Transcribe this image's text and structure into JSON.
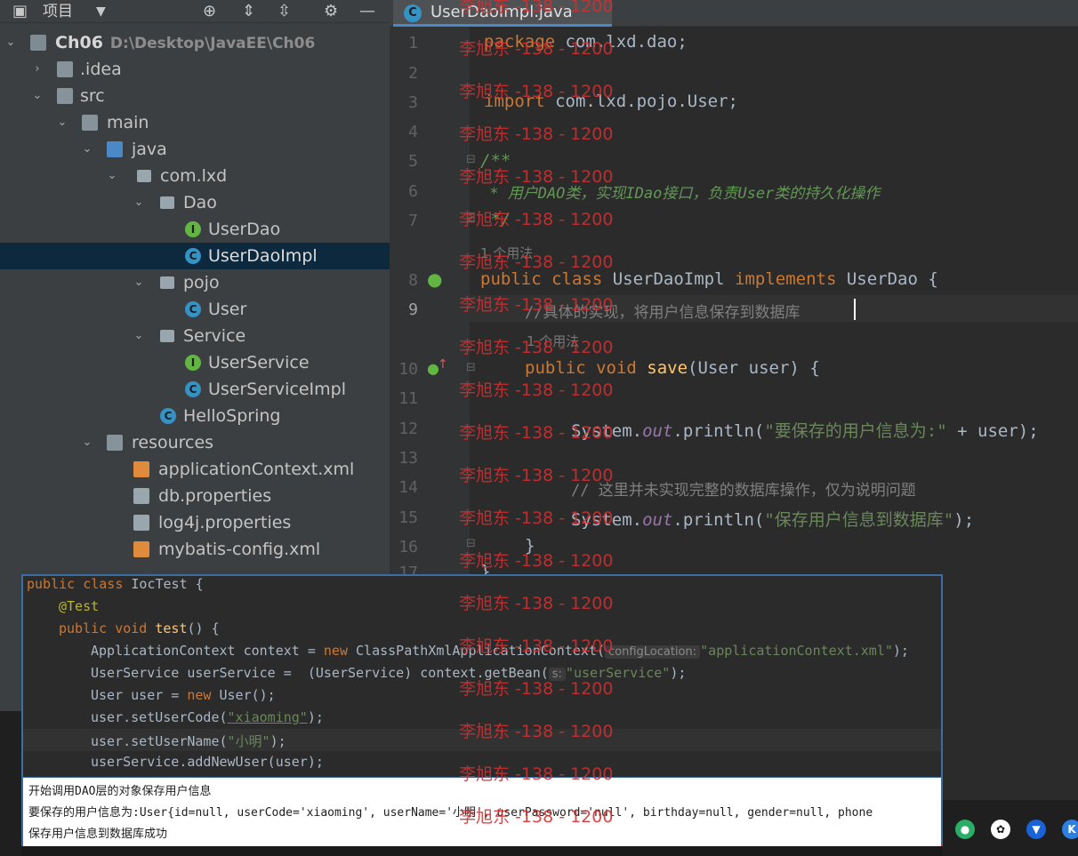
{
  "toolbar": {
    "title": "项目",
    "dropdown_icon": "chevron-down-icon",
    "crosshair_icon": "locate-icon",
    "expand_icon": "expand-all-icon",
    "collapse_icon": "collapse-all-icon",
    "settings_icon": "gear-icon",
    "minimize_icon": "minimize-icon"
  },
  "tree": {
    "root_name": "Ch06",
    "root_path": "D:\\Desktop\\JavaEE\\Ch06",
    "items": [
      {
        "label": ".idea",
        "icon": "folder-icon"
      },
      {
        "label": "src",
        "icon": "folder-icon"
      },
      {
        "label": "main",
        "icon": "folder-icon"
      },
      {
        "label": "java",
        "icon": "source-folder-icon"
      },
      {
        "label": "com.lxd",
        "icon": "package-icon"
      },
      {
        "label": "Dao",
        "icon": "package-icon"
      },
      {
        "label": "UserDao",
        "icon": "interface-icon"
      },
      {
        "label": "UserDaoImpl",
        "icon": "class-icon"
      },
      {
        "label": "pojo",
        "icon": "package-icon"
      },
      {
        "label": "User",
        "icon": "class-icon"
      },
      {
        "label": "Service",
        "icon": "package-icon"
      },
      {
        "label": "UserService",
        "icon": "interface-icon"
      },
      {
        "label": "UserServiceImpl",
        "icon": "class-icon"
      },
      {
        "label": "HelloSpring",
        "icon": "class-icon"
      },
      {
        "label": "resources",
        "icon": "resources-folder-icon"
      },
      {
        "label": "applicationContext.xml",
        "icon": "xml-file-icon"
      },
      {
        "label": "db.properties",
        "icon": "properties-file-icon"
      },
      {
        "label": "log4j.properties",
        "icon": "properties-file-icon"
      },
      {
        "label": "mybatis-config.xml",
        "icon": "xml-file-icon"
      }
    ]
  },
  "editor": {
    "tab_label": "UserDaoImpl.java",
    "line_numbers": [
      "1",
      "2",
      "3",
      "4",
      "5",
      "6",
      "7",
      "8",
      "9",
      "10",
      "11",
      "12",
      "13",
      "14",
      "15",
      "16",
      "17"
    ],
    "usage_hint_1": "1 个用法",
    "usage_hint_2": "1 个用法",
    "l1_kw": "package",
    "l1_rest": " com.lxd.dao;",
    "l3_kw": "import",
    "l3_rest": " com.lxd.pojo.User;",
    "l5": "/**",
    "l6": " * 用户DAO类，实现IDao接口，负责User类的持久化操作",
    "l7": " */",
    "l8_kw1": "public class",
    "l8_name": " UserDaoImpl ",
    "l8_kw2": "implements",
    "l8_rest": " UserDao {",
    "l9": "//具体的实现，将用户信息保存到数据库",
    "l10_kw": "public void",
    "l10_fn": " save",
    "l10_rest": "(User user) {",
    "l12_a": "System.",
    "l12_out": "out",
    "l12_b": ".println(",
    "l12_str": "\"要保存的用户信息为:\"",
    "l12_c": " + user);",
    "l14": "// 这里并未实现完整的数据库操作，仅为说明问题",
    "l15_a": "System.",
    "l15_out": "out",
    "l15_b": ".println(",
    "l15_str": "\"保存用户信息到数据库\"",
    "l15_c": ");",
    "l16": "}",
    "l17": "}"
  },
  "overlay": {
    "o1_kw": "public class",
    "o1_rest": " IocTest {",
    "o2": "@Test",
    "o3_kw": "public void",
    "o3_fn": " test",
    "o3_rest": "() {",
    "o4_a": "ApplicationContext context = ",
    "o4_kw": "new",
    "o4_b": " ClassPathXmlApplicationContext(",
    "o4_hint": "configLocation:",
    "o4_str": "\"applicationContext.xml\"",
    "o4_c": ");",
    "o5_a": "UserService userService =  (UserService) context.getBean(",
    "o5_hint": "s:",
    "o5_str": "\"userService\"",
    "o5_c": ");",
    "o6_a": "User user = ",
    "o6_kw": "new",
    "o6_b": " User();",
    "o7_a": "user.setUserCode(",
    "o7_str": "\"xiaoming\"",
    "o7_c": ");",
    "o8_a": "user.setUserName(",
    "o8_str": "\"小明\"",
    "o8_c": ");",
    "o9": "userService.addNewUser(user);",
    "console": [
      "开始调用DAO层的对象保存用户信息",
      "要保存的用户信息为:User{id=null, userCode='xiaoming', userName='小明', userPassword='null', birthday=null, gender=null, phone",
      "保存用户信息到数据库成功"
    ]
  },
  "watermark": "李旭东 -138 - 1200",
  "colors": {
    "keyword": "#cc7832",
    "string": "#6a8759",
    "function": "#ffc66d",
    "doc_comment": "#629755",
    "watermark": "#d32f2f",
    "selection": "#0d293e"
  }
}
